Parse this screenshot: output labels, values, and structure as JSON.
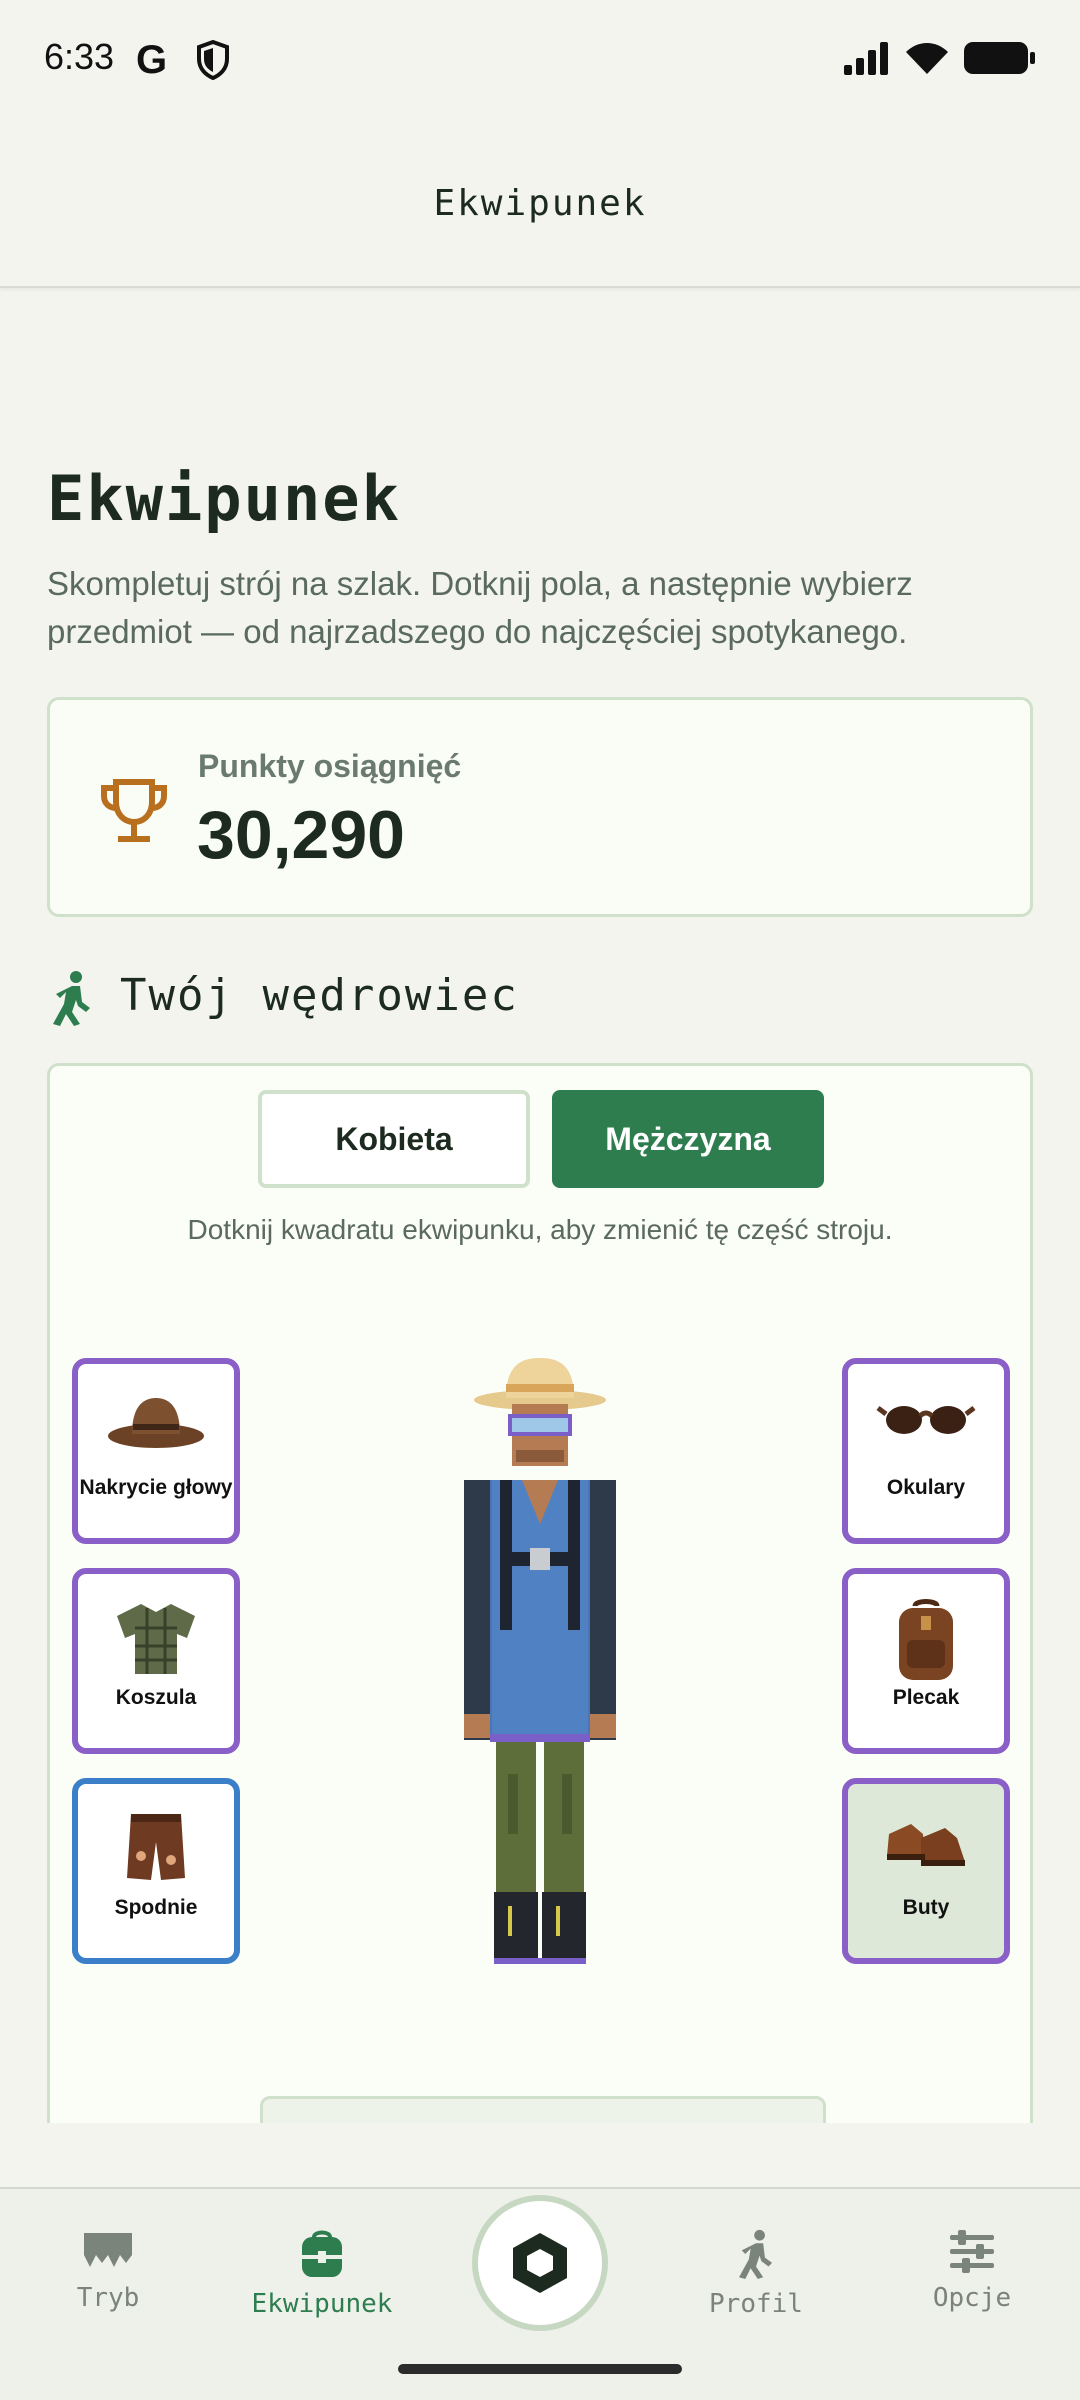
{
  "status_bar": {
    "time": "6:33",
    "g_label": "G"
  },
  "app_bar": {
    "title": "Ekwipunek"
  },
  "page": {
    "title": "Ekwipunek",
    "description": "Skompletuj strój na szlak. Dotknij pola, a następnie wybierz przedmiot — od najrzadszego do najczęściej spotykanego."
  },
  "points": {
    "label": "Punkty osiągnięć",
    "value": "30,290"
  },
  "wanderer": {
    "section_title": "Twój wędrowiec",
    "gender_female": "Kobieta",
    "gender_male": "Mężczyzna",
    "selected_gender": "Mężczyzna",
    "hint": "Dotknij kwadratu ekwipunku, aby zmienić tę część stroju.",
    "slots": {
      "headwear": "Nakrycie głowy",
      "shirt": "Koszula",
      "pants": "Spodnie",
      "glasses": "Okulary",
      "backpack": "Plecak",
      "boots": "Buty"
    }
  },
  "nav": {
    "items": [
      {
        "label": "Tryb",
        "icon": "map-icon"
      },
      {
        "label": "Ekwipunek",
        "icon": "backpack-icon",
        "active": true
      },
      {
        "label": "",
        "icon": "hexagon-icon"
      },
      {
        "label": "Profil",
        "icon": "walker-icon"
      },
      {
        "label": "Opcje",
        "icon": "sliders-icon"
      }
    ]
  },
  "colors": {
    "accent_green": "#2e7d4f",
    "slot_purple": "#8b5fc8",
    "slot_blue": "#3b7fc9",
    "trophy": "#b8701e"
  }
}
